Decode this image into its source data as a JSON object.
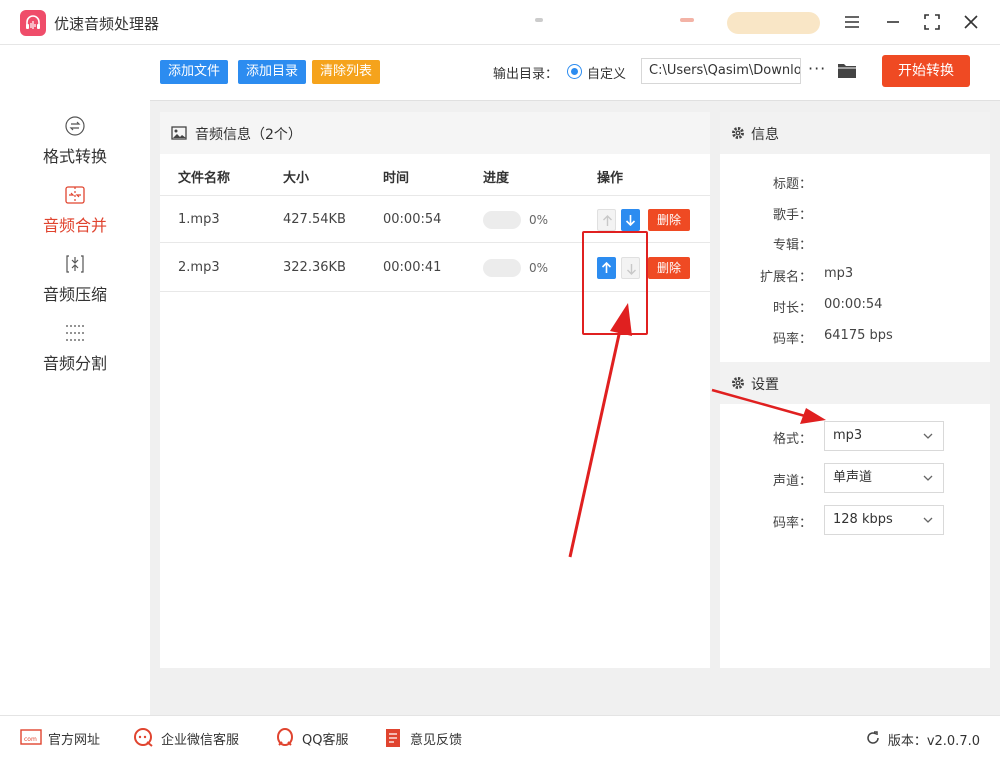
{
  "app": {
    "title": "优速音频处理器"
  },
  "sidebar": {
    "items": [
      {
        "label": "格式转换",
        "icon": "convert-icon",
        "active": false
      },
      {
        "label": "音频合并",
        "icon": "merge-icon",
        "active": true
      },
      {
        "label": "音频压缩",
        "icon": "compress-icon",
        "active": false
      },
      {
        "label": "音频分割",
        "icon": "split-icon",
        "active": false
      }
    ]
  },
  "toolbar": {
    "add_file": "添加文件",
    "add_folder": "添加目录",
    "clear_list": "清除列表",
    "output_label": "输出目录：",
    "custom_label": "自定义",
    "output_path": "C:\\Users\\Qasim\\Downlo",
    "more": "···",
    "start": "开始转换"
  },
  "file_panel": {
    "title": "音频信息（2个）",
    "columns": [
      "文件名称",
      "大小",
      "时间",
      "进度",
      "操作"
    ],
    "rows": [
      {
        "name": "1.mp3",
        "size": "427.54KB",
        "time": "00:00:54",
        "progress": "0%",
        "delete": "删除"
      },
      {
        "name": "2.mp3",
        "size": "322.36KB",
        "time": "00:00:41",
        "progress": "0%",
        "delete": "删除"
      }
    ]
  },
  "info_panel": {
    "title": "信息",
    "fields": [
      {
        "label": "标题：",
        "value": ""
      },
      {
        "label": "歌手：",
        "value": ""
      },
      {
        "label": "专辑：",
        "value": ""
      },
      {
        "label": "扩展名：",
        "value": "mp3"
      },
      {
        "label": "时长：",
        "value": "00:00:54"
      },
      {
        "label": "码率：",
        "value": "64175 bps"
      }
    ]
  },
  "settings_panel": {
    "title": "设置",
    "format_label": "格式：",
    "format_value": "mp3",
    "channel_label": "声道：",
    "channel_value": "单声道",
    "bitrate_label": "码率：",
    "bitrate_value": "128 kbps"
  },
  "footer": {
    "website": "官方网址",
    "wechat": "企业微信客服",
    "qq": "QQ客服",
    "feedback": "意见反馈",
    "version": "版本：v2.0.7.0"
  },
  "colors": {
    "accent_blue": "#2c8cf0",
    "accent_red": "#ef4a23",
    "accent_orange": "#f5a31c",
    "annotation_red": "#e02020"
  }
}
